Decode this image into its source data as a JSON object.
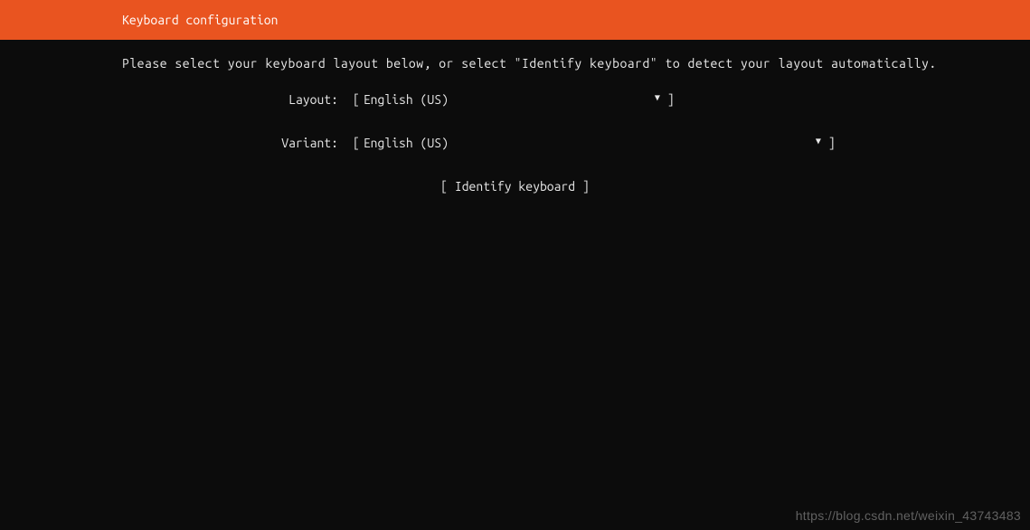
{
  "header": {
    "title": "Keyboard configuration"
  },
  "main": {
    "instruction": "Please select your keyboard layout below, or select \"Identify keyboard\" to detect your layout automatically.",
    "layout": {
      "label": "Layout:",
      "value": "English (US)"
    },
    "variant": {
      "label": "Variant:",
      "value": "English (US)"
    },
    "identify_button": "Identify keyboard"
  },
  "watermark": "https://blog.csdn.net/weixin_43743483"
}
